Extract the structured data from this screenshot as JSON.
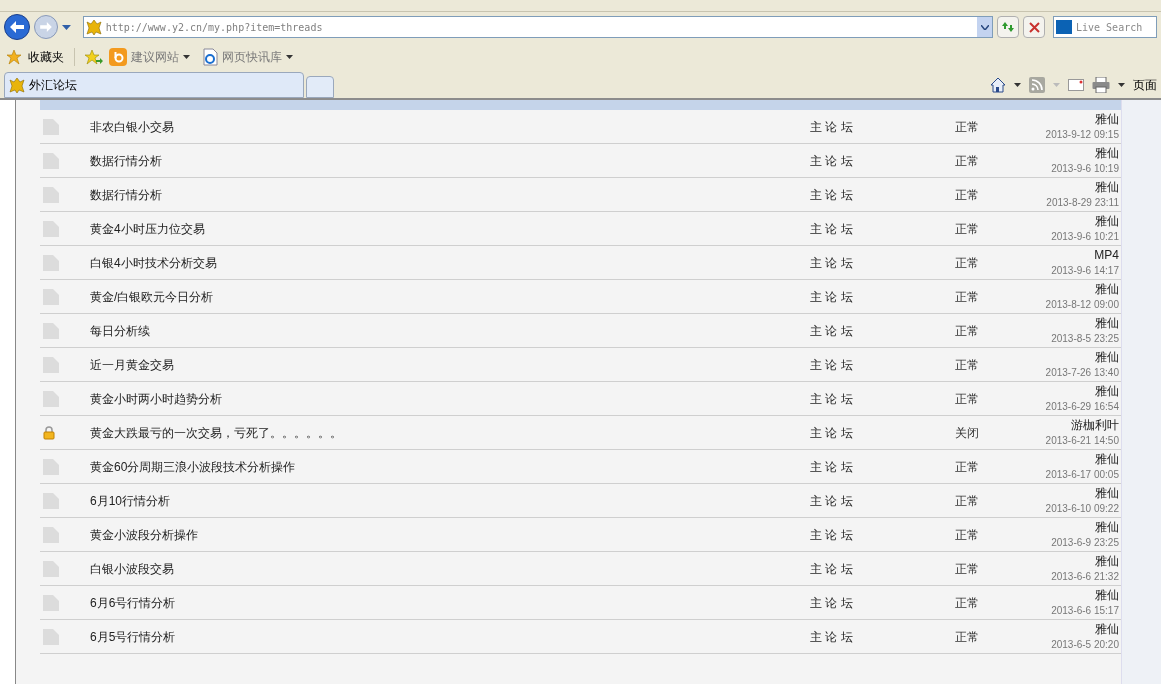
{
  "browser": {
    "address": "http://www.y2.cn/my.php?item=threads",
    "search_placeholder": "Live Search",
    "favorites_label": "收藏夹",
    "links": [
      {
        "label": "建议网站",
        "kind": "suggest"
      },
      {
        "label": "网页快讯库",
        "kind": "slices"
      }
    ],
    "tab_title": "外汇论坛",
    "page_menu": "页面"
  },
  "threads": [
    {
      "title": "非农白银小交易",
      "forum": "主 论 坛",
      "status": "正常",
      "locked": false,
      "author": "雅仙",
      "time": "2013-9-12 09:15"
    },
    {
      "title": "数据行情分析",
      "forum": "主 论 坛",
      "status": "正常",
      "locked": false,
      "author": "雅仙",
      "time": "2013-9-6 10:19"
    },
    {
      "title": "数据行情分析",
      "forum": "主 论 坛",
      "status": "正常",
      "locked": false,
      "author": "雅仙",
      "time": "2013-8-29 23:11"
    },
    {
      "title": "黄金4小时压力位交易",
      "forum": "主 论 坛",
      "status": "正常",
      "locked": false,
      "author": "雅仙",
      "time": "2013-9-6 10:21"
    },
    {
      "title": "白银4小时技术分析交易",
      "forum": "主 论 坛",
      "status": "正常",
      "locked": false,
      "author": "MP4",
      "time": "2013-9-6 14:17"
    },
    {
      "title": "黄金/白银欧元今日分析",
      "forum": "主 论 坛",
      "status": "正常",
      "locked": false,
      "author": "雅仙",
      "time": "2013-8-12 09:00"
    },
    {
      "title": "每日分析续",
      "forum": "主 论 坛",
      "status": "正常",
      "locked": false,
      "author": "雅仙",
      "time": "2013-8-5 23:25"
    },
    {
      "title": "近一月黄金交易",
      "forum": "主 论 坛",
      "status": "正常",
      "locked": false,
      "author": "雅仙",
      "time": "2013-7-26 13:40"
    },
    {
      "title": "黄金小时两小时趋势分析",
      "forum": "主 论 坛",
      "status": "正常",
      "locked": false,
      "author": "雅仙",
      "time": "2013-6-29 16:54"
    },
    {
      "title": "黄金大跌最亏的一次交易，亏死了。。。。。。",
      "forum": "主 论 坛",
      "status": "关闭",
      "locked": true,
      "author": "游枷利叶",
      "time": "2013-6-21 14:50"
    },
    {
      "title": "黄金60分周期三浪小波段技术分析操作",
      "forum": "主 论 坛",
      "status": "正常",
      "locked": false,
      "author": "雅仙",
      "time": "2013-6-17 00:05"
    },
    {
      "title": "6月10行情分析",
      "forum": "主 论 坛",
      "status": "正常",
      "locked": false,
      "author": "雅仙",
      "time": "2013-6-10 09:22"
    },
    {
      "title": "黄金小波段分析操作",
      "forum": "主 论 坛",
      "status": "正常",
      "locked": false,
      "author": "雅仙",
      "time": "2013-6-9 23:25"
    },
    {
      "title": "白银小波段交易",
      "forum": "主 论 坛",
      "status": "正常",
      "locked": false,
      "author": "雅仙",
      "time": "2013-6-6 21:32"
    },
    {
      "title": "6月6号行情分析",
      "forum": "主 论 坛",
      "status": "正常",
      "locked": false,
      "author": "雅仙",
      "time": "2013-6-6 15:17"
    },
    {
      "title": "6月5号行情分析",
      "forum": "主 论 坛",
      "status": "正常",
      "locked": false,
      "author": "雅仙",
      "time": "2013-6-5 20:20"
    }
  ]
}
